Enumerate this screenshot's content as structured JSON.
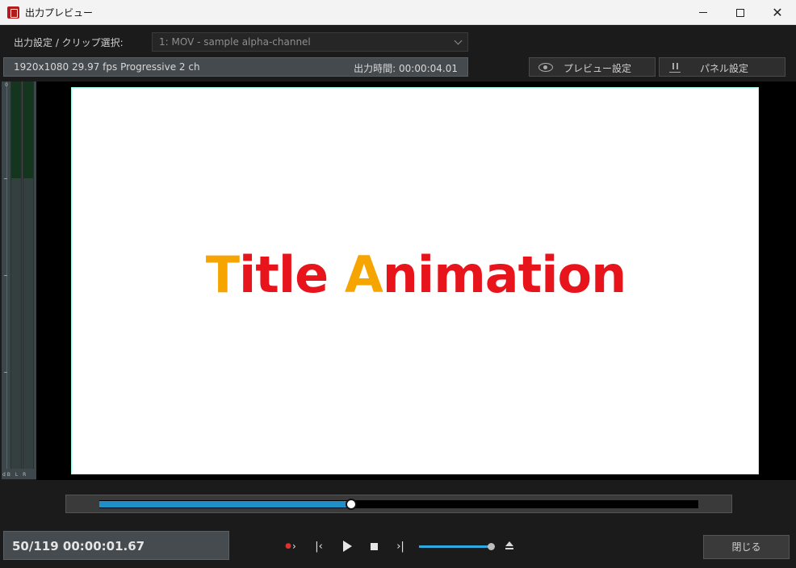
{
  "window": {
    "title": "出力プレビュー",
    "close_glyph": "✕"
  },
  "output": {
    "label": "出力設定 / クリップ選択:",
    "selected_clip": "1: MOV - sample alpha-channel",
    "format": "1920x1080 29.97 fps Progressive 2 ch",
    "duration": "出力時間: 00:00:04.01"
  },
  "buttons": {
    "preview_settings": "プレビュー設定",
    "panel_settings": "パネル設定",
    "close": "閉じる"
  },
  "meter": {
    "top_label": "0",
    "bottom_labels": "dB L R"
  },
  "preview": {
    "title_part1_accent": "T",
    "title_part1_rest": "itle ",
    "title_part2_accent": "A",
    "title_part2_rest": "nimation",
    "colors": {
      "red": "#e8141c",
      "orange": "#f5a400"
    }
  },
  "timeline": {
    "current_frame": 50,
    "total_frames": 119,
    "progress": 0.42
  },
  "status": {
    "counter": "50/119  00:00:01.67"
  },
  "transport": {
    "rec_marker_icon": "record-in-icon",
    "prev_icon": "skip-back-icon",
    "play_icon": "play-icon",
    "stop_icon": "stop-icon",
    "next_icon": "skip-forward-icon",
    "speed_level": 1.0,
    "eject_icon": "eject-icon"
  },
  "accent_color": "#1e8fc7"
}
